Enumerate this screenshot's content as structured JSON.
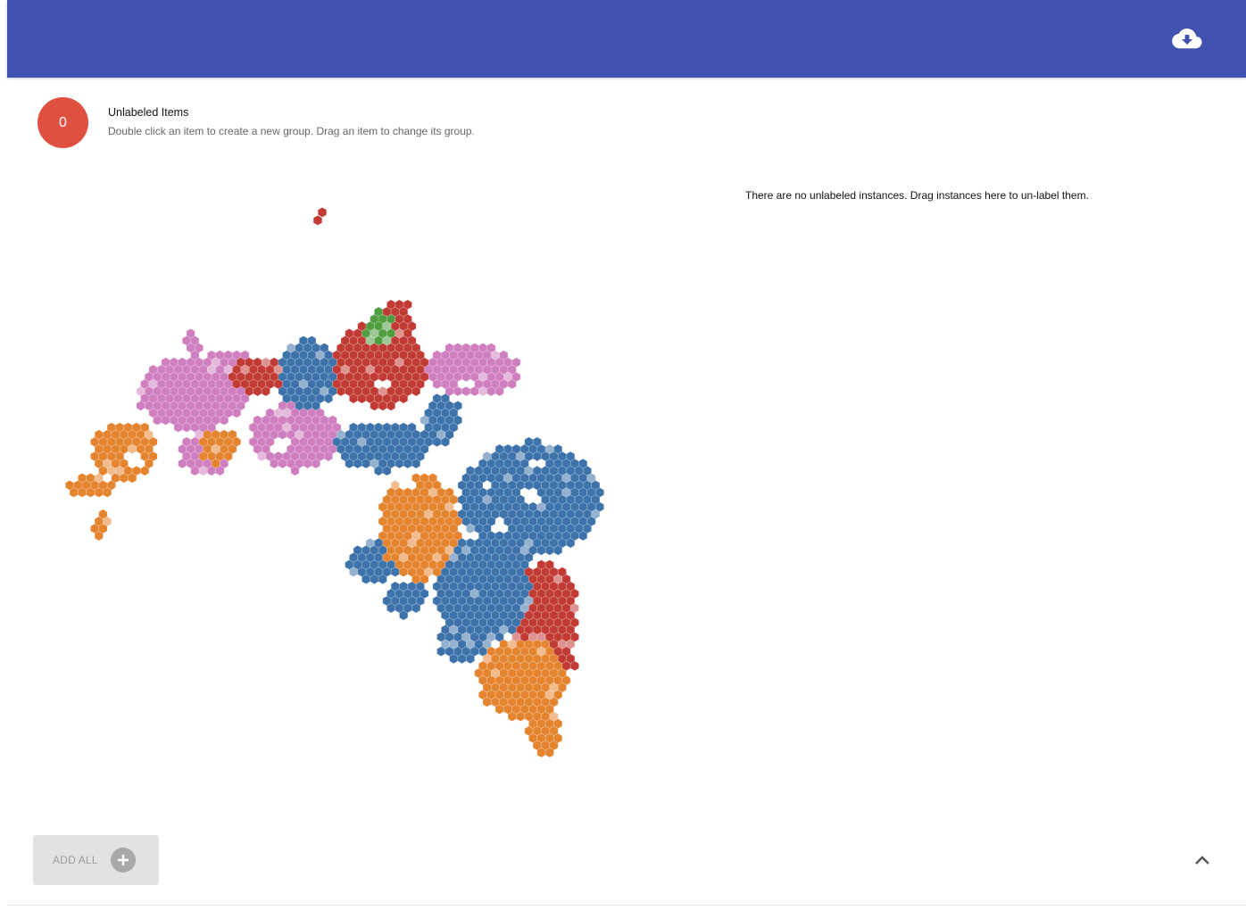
{
  "header": {
    "download_icon": "cloud-download-icon",
    "bar_color": "#4051b0"
  },
  "group": {
    "count": "0",
    "title": "Unlabeled Items",
    "subtitle": "Double click an item to create a new group. Drag an item to change its group.",
    "badge_color": "#e05041"
  },
  "instances": {
    "empty_message": "There are no unlabeled instances. Drag instances here to un-label them."
  },
  "footer": {
    "add_all_label": "ADD ALL",
    "add_icon": "plus-circle-icon",
    "collapse_icon": "chevron-up-icon"
  },
  "map": {
    "palette": {
      "blue": "#3d72aa",
      "red": "#c23a34",
      "pink": "#cf7fbf",
      "orange": "#e5842f",
      "green": "#4f9d3f"
    }
  }
}
